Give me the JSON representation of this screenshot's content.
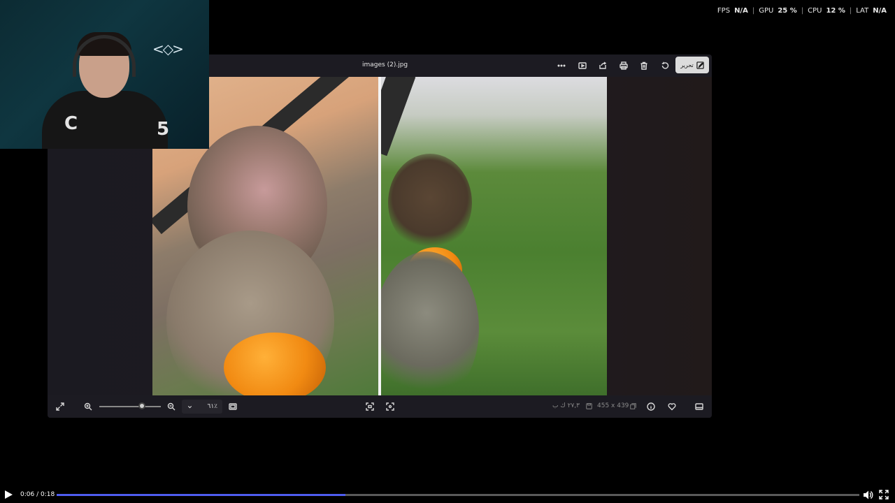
{
  "perf": {
    "fps_label": "FPS",
    "fps_value": "N/A",
    "gpu_label": "GPU",
    "gpu_value": "25 %",
    "cpu_label": "CPU",
    "cpu_value": "12 %",
    "lat_label": "LAT",
    "lat_value": "N/A",
    "separator": "|"
  },
  "viewer": {
    "filename": "images (2).jpg",
    "toolbar_icons": [
      "more-icon",
      "slideshow-icon",
      "share-icon",
      "print-icon",
      "delete-icon",
      "rotate-icon"
    ],
    "edit_label": "تحرير",
    "zoom_value": "٦١٪",
    "file_size": "٢٧,٣ ك ب",
    "dimensions": "455 x 439",
    "bottom_icons": [
      "expand-icon",
      "zoom-in-icon",
      "zoom-out-icon",
      "chevron-down-icon",
      "fit-icon",
      "actual-size-icon",
      "crop-icon",
      "info-icon",
      "favorite-icon",
      "filmstrip-icon"
    ]
  },
  "webcam": {
    "logo": "<◇>",
    "shirt_letters": [
      "C",
      "5"
    ]
  },
  "player": {
    "time": "0:06 / 0:18",
    "progress": 0.36,
    "accent": "#4e5cf0"
  }
}
